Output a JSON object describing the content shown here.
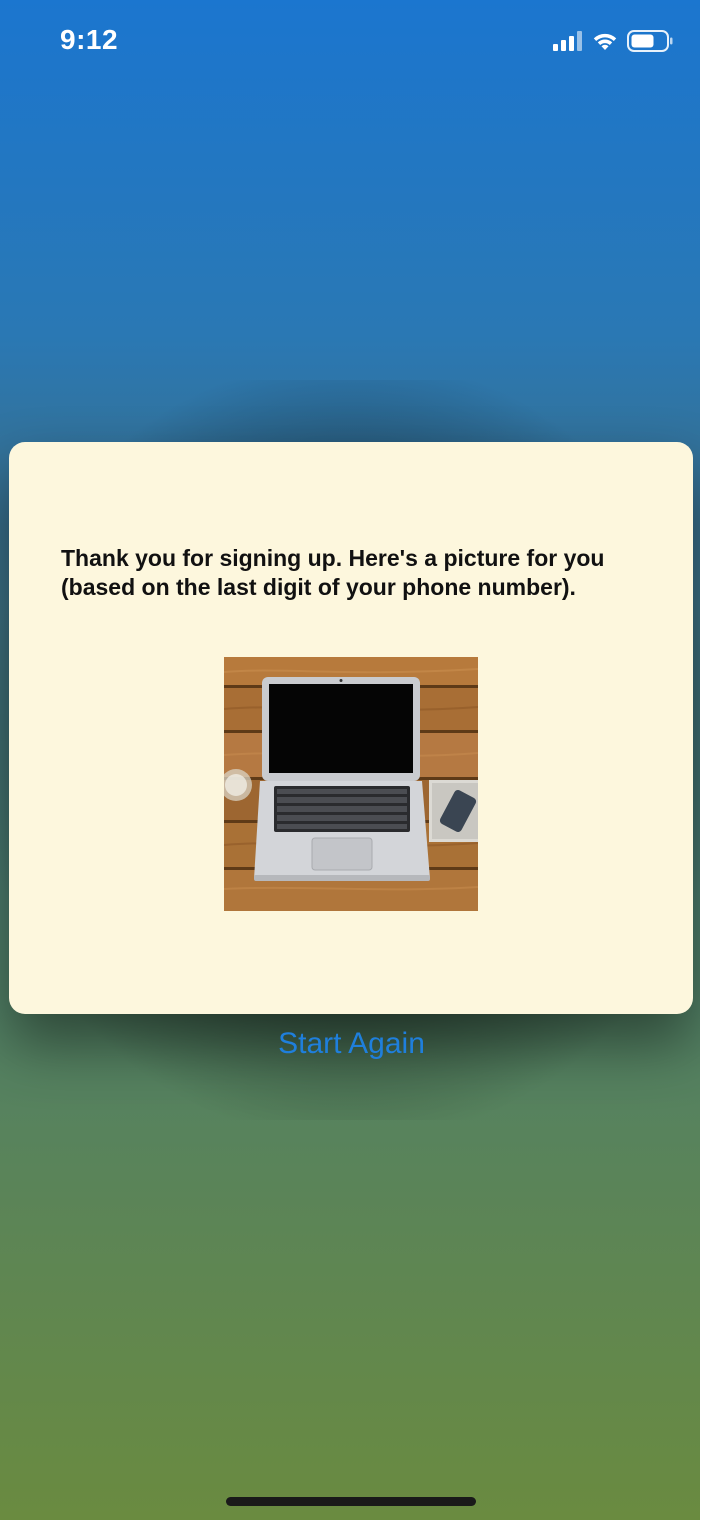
{
  "status_bar": {
    "time": "9:12",
    "icons": [
      "signal-icon",
      "wifi-icon",
      "battery-icon"
    ]
  },
  "modal": {
    "message": "Thank you for signing up. Here's a picture for you (based on the last digit of your phone number).",
    "image": {
      "subject": "laptop-on-wooden-desk"
    }
  },
  "actions": {
    "start_again_label": "Start Again"
  },
  "colors": {
    "accent": "#1f7fdc",
    "modal_background": "#fdf7dd",
    "gradient_top": "#1b76cf",
    "gradient_bottom": "#6a8b40"
  }
}
